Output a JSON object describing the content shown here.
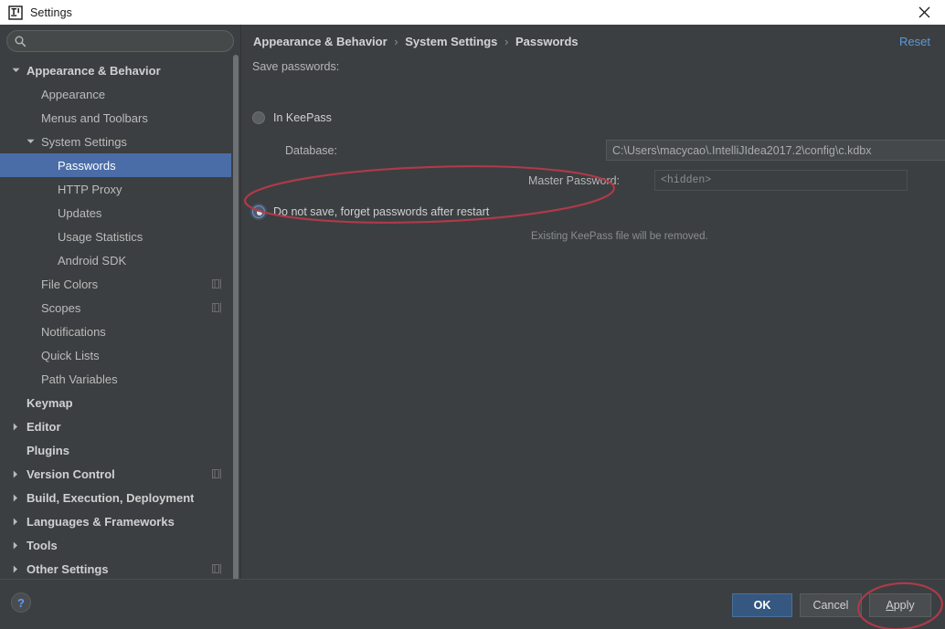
{
  "window": {
    "title": "Settings",
    "app_icon": "intellij-idea-icon",
    "close_icon": "close-icon"
  },
  "sidebar": {
    "search": {
      "value": "",
      "placeholder": "",
      "icon": "search-icon"
    },
    "items": [
      {
        "label": "Appearance & Behavior",
        "indent": 0,
        "twisty": "down",
        "bold": true,
        "selected": false,
        "project_icon": false
      },
      {
        "label": "Appearance",
        "indent": 1,
        "twisty": "none",
        "bold": false,
        "selected": false,
        "project_icon": false
      },
      {
        "label": "Menus and Toolbars",
        "indent": 1,
        "twisty": "none",
        "bold": false,
        "selected": false,
        "project_icon": false
      },
      {
        "label": "System Settings",
        "indent": 1,
        "twisty": "down",
        "bold": false,
        "selected": false,
        "project_icon": false
      },
      {
        "label": "Passwords",
        "indent": 2,
        "twisty": "none",
        "bold": false,
        "selected": true,
        "project_icon": false
      },
      {
        "label": "HTTP Proxy",
        "indent": 2,
        "twisty": "none",
        "bold": false,
        "selected": false,
        "project_icon": false
      },
      {
        "label": "Updates",
        "indent": 2,
        "twisty": "none",
        "bold": false,
        "selected": false,
        "project_icon": false
      },
      {
        "label": "Usage Statistics",
        "indent": 2,
        "twisty": "none",
        "bold": false,
        "selected": false,
        "project_icon": false
      },
      {
        "label": "Android SDK",
        "indent": 2,
        "twisty": "none",
        "bold": false,
        "selected": false,
        "project_icon": false
      },
      {
        "label": "File Colors",
        "indent": 1,
        "twisty": "none",
        "bold": false,
        "selected": false,
        "project_icon": true
      },
      {
        "label": "Scopes",
        "indent": 1,
        "twisty": "none",
        "bold": false,
        "selected": false,
        "project_icon": true
      },
      {
        "label": "Notifications",
        "indent": 1,
        "twisty": "none",
        "bold": false,
        "selected": false,
        "project_icon": false
      },
      {
        "label": "Quick Lists",
        "indent": 1,
        "twisty": "none",
        "bold": false,
        "selected": false,
        "project_icon": false
      },
      {
        "label": "Path Variables",
        "indent": 1,
        "twisty": "none",
        "bold": false,
        "selected": false,
        "project_icon": false
      },
      {
        "label": "Keymap",
        "indent": 0,
        "twisty": "none",
        "bold": true,
        "selected": false,
        "project_icon": false
      },
      {
        "label": "Editor",
        "indent": 0,
        "twisty": "right",
        "bold": true,
        "selected": false,
        "project_icon": false
      },
      {
        "label": "Plugins",
        "indent": 0,
        "twisty": "none",
        "bold": true,
        "selected": false,
        "project_icon": false
      },
      {
        "label": "Version Control",
        "indent": 0,
        "twisty": "right",
        "bold": true,
        "selected": false,
        "project_icon": true
      },
      {
        "label": "Build, Execution, Deployment",
        "indent": 0,
        "twisty": "right",
        "bold": true,
        "selected": false,
        "project_icon": false
      },
      {
        "label": "Languages & Frameworks",
        "indent": 0,
        "twisty": "right",
        "bold": true,
        "selected": false,
        "project_icon": false
      },
      {
        "label": "Tools",
        "indent": 0,
        "twisty": "right",
        "bold": true,
        "selected": false,
        "project_icon": false
      },
      {
        "label": "Other Settings",
        "indent": 0,
        "twisty": "right",
        "bold": true,
        "selected": false,
        "project_icon": true
      }
    ]
  },
  "content": {
    "breadcrumb": {
      "part1": "Appearance & Behavior",
      "sep1": "›",
      "part2": "System Settings",
      "sep2": "›",
      "part3": "Passwords"
    },
    "reset_label": "Reset",
    "save_passwords_label": "Save passwords:",
    "option_keepass": {
      "label": "In KeePass",
      "selected": false
    },
    "database_label": "Database:",
    "database_value": "C:\\Users\\macycao\\.IntelliJIdea2017.2\\config\\c.kdbx",
    "database_dropdown_icon": "chevron-down-icon",
    "database_browse_label": "…",
    "master_password_label": "Master Password:",
    "master_password_value": "<hidden>",
    "option_forget": {
      "label": "Do not save, forget passwords after restart",
      "selected": true
    },
    "forget_hint": "Existing KeePass file will be removed."
  },
  "annotations": {
    "color": "#b03a4a",
    "ellipse_radio": "red-ellipse-around-forget-option",
    "ellipse_apply": "red-ellipse-around-apply-button"
  },
  "footer": {
    "help_label": "?",
    "ok_label": "OK",
    "cancel_label": "Cancel",
    "apply_mnemonic": "A",
    "apply_rest": "pply"
  }
}
